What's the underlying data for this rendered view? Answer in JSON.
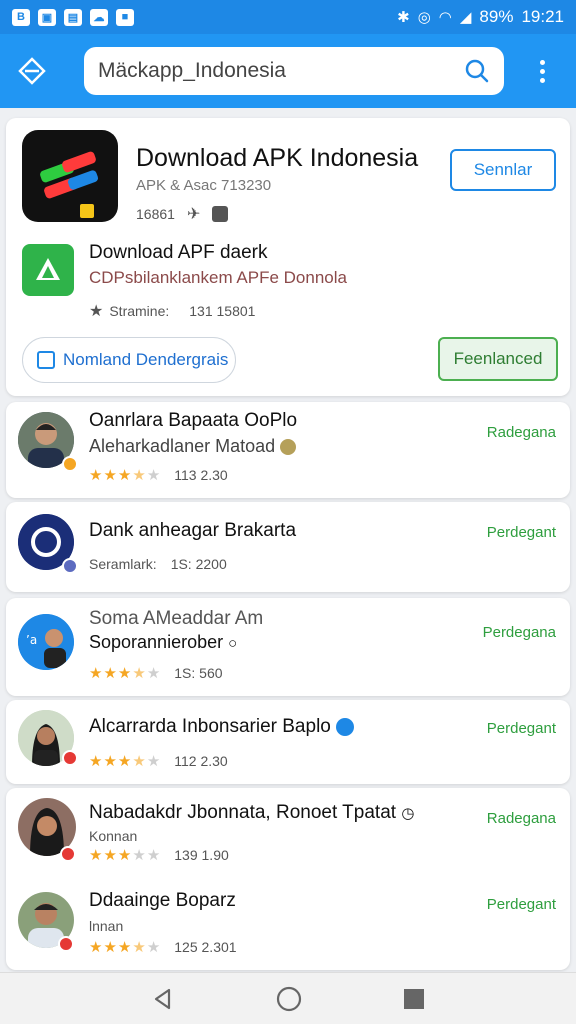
{
  "status": {
    "time": "19:21",
    "battery": "89%"
  },
  "search": {
    "query": "Mäckapp_Indonesia"
  },
  "featured": {
    "title": "Download APK Indonesia",
    "subtitle": "APK & Asac 713230",
    "meta_count": "16861",
    "button": "Sennlar"
  },
  "secondary": {
    "title": "Download APF daerk",
    "description": "CDPsbilanklankem APFe Donnola",
    "meta_label": "Stramine:",
    "meta_value": "131 15801",
    "pill_button": "Nomland Dendergrais",
    "green_button": "Feenlanced"
  },
  "rows": [
    {
      "title": "Oanrlara Bapaata OoPlo",
      "subtitle": "Aleharkadlaner Matoad",
      "rating": 3.5,
      "count": "113 2.30",
      "action": "Radegana"
    },
    {
      "title": "Dank anheagar Brakarta",
      "meta_label": "Seramlark:",
      "count": "1S: 2200",
      "action": "Perdegant"
    },
    {
      "title": "Soma AMeaddar Am",
      "subtitle": "Soporannierober",
      "rating": 3.5,
      "count": "1S: 560",
      "action": "Perdegana"
    },
    {
      "title": "Alcarrarda Inbonsarier Baplo",
      "rating": 3.5,
      "count": "112 2.30",
      "action": "Perdegant"
    },
    {
      "title": "Nabadakdr Jbonnata, Ronoet Tpatat",
      "subtitle": "Konnan",
      "rating": 3,
      "count": "139 1.90",
      "action": "Radegana"
    },
    {
      "title": "Ddaainge Boparz",
      "subtitle": "lnnan",
      "rating": 3.5,
      "count": "125 2.301",
      "action": "Perdegant"
    }
  ],
  "colors": {
    "primary": "#2196f3",
    "accent_green": "#2e9e3e",
    "star": "#f5a623"
  }
}
